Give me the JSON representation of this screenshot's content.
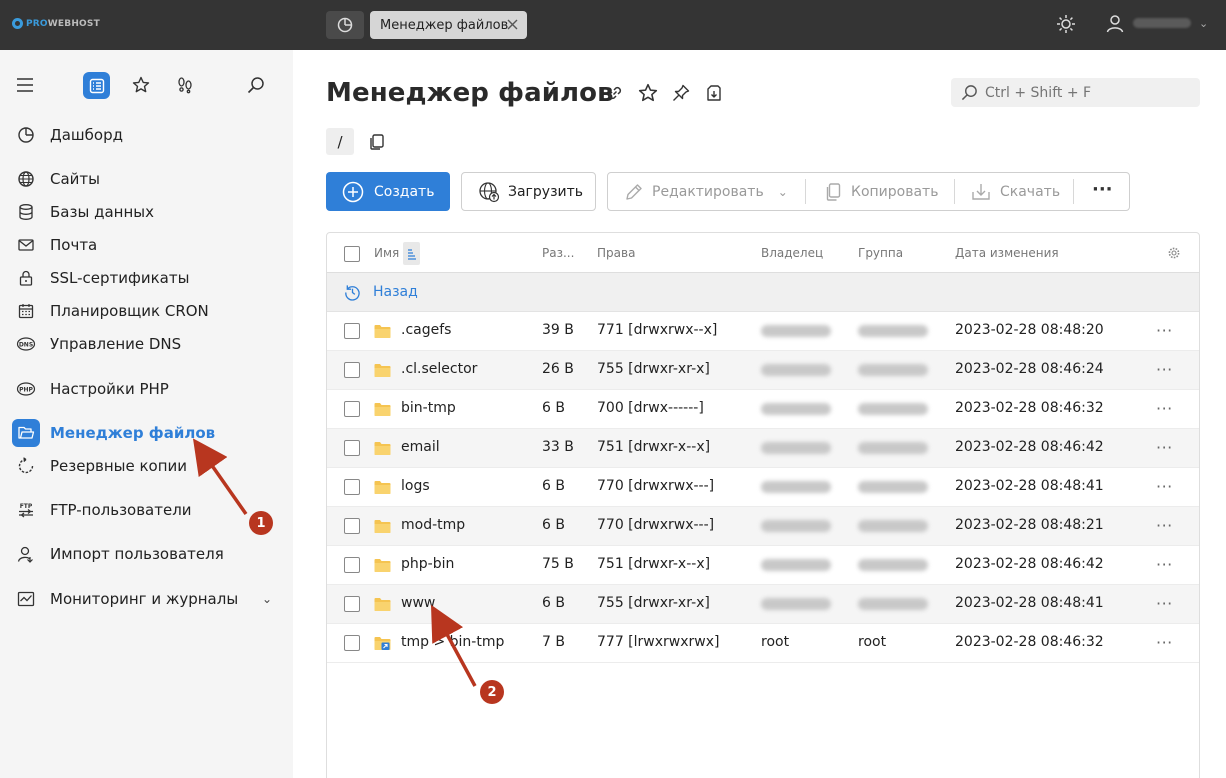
{
  "app": {
    "logo_text_a": "PRO",
    "logo_text_b": "WEBHOST",
    "open_tab": "Менеджер файлов"
  },
  "colors": {
    "accent": "#2f7fd8",
    "topbar": "#343434",
    "annotation": "#b8361f"
  },
  "sidebar": {
    "items": [
      {
        "label": "Дашборд",
        "icon": "dashboard-icon"
      },
      {
        "label": "Сайты",
        "icon": "globe-icon"
      },
      {
        "label": "Базы данных",
        "icon": "database-icon"
      },
      {
        "label": "Почта",
        "icon": "mail-icon"
      },
      {
        "label": "SSL-сертификаты",
        "icon": "lock-icon"
      },
      {
        "label": "Планировщик CRON",
        "icon": "calendar-icon"
      },
      {
        "label": "Управление DNS",
        "icon": "dns-icon"
      },
      {
        "label": "Настройки PHP",
        "icon": "php-icon"
      },
      {
        "label": "Менеджер файлов",
        "icon": "folder-icon",
        "active": true
      },
      {
        "label": "Резервные копии",
        "icon": "backup-icon"
      },
      {
        "label": "FTP-пользователи",
        "icon": "ftp-icon"
      },
      {
        "label": "Импорт пользователя",
        "icon": "user-import-icon"
      },
      {
        "label": "Мониторинг и журналы",
        "icon": "monitoring-icon"
      }
    ]
  },
  "main": {
    "title": "Менеджер файлов",
    "search_placeholder": "Ctrl + Shift + F",
    "path": "/",
    "toolbar": {
      "create": "Создать",
      "upload": "Загрузить",
      "edit": "Редактировать",
      "copy": "Копировать",
      "download": "Скачать"
    },
    "table": {
      "headers": {
        "name": "Имя",
        "size": "Раз...",
        "perms": "Права",
        "owner": "Владелец",
        "group": "Группа",
        "modified": "Дата изменения"
      },
      "back": "Назад",
      "rows": [
        {
          "name": ".cagefs",
          "size": "39 B",
          "perms": "771 [drwxrwx--x]",
          "owner": "",
          "group": "",
          "modified": "2023-02-28 08:48:20"
        },
        {
          "name": ".cl.selector",
          "size": "26 B",
          "perms": "755 [drwxr-xr-x]",
          "owner": "",
          "group": "",
          "modified": "2023-02-28 08:46:24"
        },
        {
          "name": "bin-tmp",
          "size": "6 B",
          "perms": "700 [drwx------]",
          "owner": "",
          "group": "",
          "modified": "2023-02-28 08:46:32"
        },
        {
          "name": "email",
          "size": "33 B",
          "perms": "751 [drwxr-x--x]",
          "owner": "",
          "group": "",
          "modified": "2023-02-28 08:46:42"
        },
        {
          "name": "logs",
          "size": "6 B",
          "perms": "770 [drwxrwx---]",
          "owner": "",
          "group": "",
          "modified": "2023-02-28 08:48:41"
        },
        {
          "name": "mod-tmp",
          "size": "6 B",
          "perms": "770 [drwxrwx---]",
          "owner": "",
          "group": "",
          "modified": "2023-02-28 08:48:21"
        },
        {
          "name": "php-bin",
          "size": "75 B",
          "perms": "751 [drwxr-x--x]",
          "owner": "",
          "group": "",
          "modified": "2023-02-28 08:46:42"
        },
        {
          "name": "www",
          "size": "6 B",
          "perms": "755 [drwxr-xr-x]",
          "owner": "",
          "group": "",
          "modified": "2023-02-28 08:48:41"
        },
        {
          "name": "tmp > bin-tmp",
          "size": "7 B",
          "perms": "777 [lrwxrwxrwx]",
          "owner": "root",
          "group": "root",
          "modified": "2023-02-28 08:46:32",
          "symlink": true
        }
      ]
    }
  },
  "annotations": {
    "badge_1": "1",
    "badge_2": "2"
  }
}
